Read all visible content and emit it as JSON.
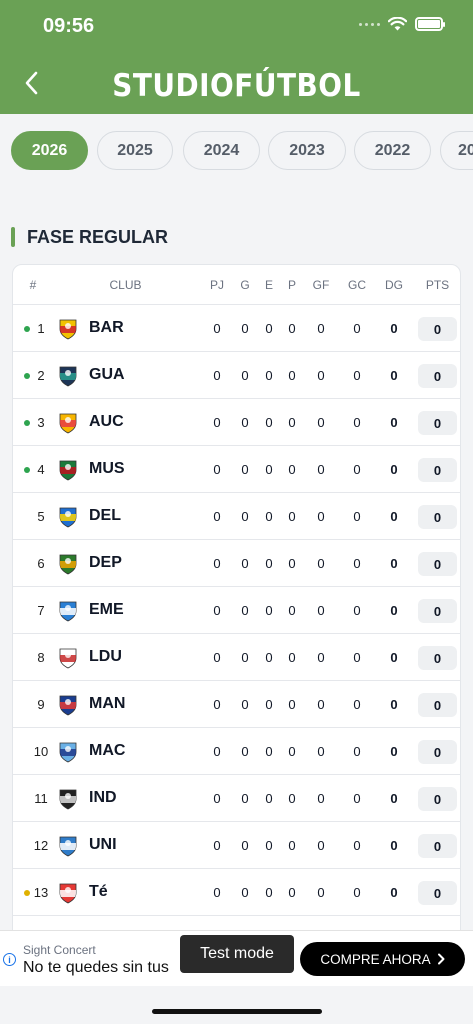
{
  "status_bar": {
    "time": "09:56"
  },
  "header": {
    "title": "STUDIOFÚTBOL",
    "back_icon": "chevron-left-icon"
  },
  "years": [
    "2026",
    "2025",
    "2024",
    "2023",
    "2022",
    "20"
  ],
  "active_year": "2026",
  "section": {
    "title": "FASE REGULAR"
  },
  "table": {
    "columns": [
      "#",
      "CLUB",
      "PJ",
      "G",
      "E",
      "P",
      "GF",
      "GC",
      "DG",
      "PTS"
    ],
    "rows": [
      {
        "pos": "1",
        "club": "BAR",
        "pj": "0",
        "g": "0",
        "e": "0",
        "p": "0",
        "gf": "0",
        "gc": "0",
        "dg": "0",
        "pts": "0",
        "marker": "green"
      },
      {
        "pos": "2",
        "club": "GUA",
        "pj": "0",
        "g": "0",
        "e": "0",
        "p": "0",
        "gf": "0",
        "gc": "0",
        "dg": "0",
        "pts": "0",
        "marker": "green"
      },
      {
        "pos": "3",
        "club": "AUC",
        "pj": "0",
        "g": "0",
        "e": "0",
        "p": "0",
        "gf": "0",
        "gc": "0",
        "dg": "0",
        "pts": "0",
        "marker": "green"
      },
      {
        "pos": "4",
        "club": "MUS",
        "pj": "0",
        "g": "0",
        "e": "0",
        "p": "0",
        "gf": "0",
        "gc": "0",
        "dg": "0",
        "pts": "0",
        "marker": "green"
      },
      {
        "pos": "5",
        "club": "DEL",
        "pj": "0",
        "g": "0",
        "e": "0",
        "p": "0",
        "gf": "0",
        "gc": "0",
        "dg": "0",
        "pts": "0",
        "marker": ""
      },
      {
        "pos": "6",
        "club": "DEP",
        "pj": "0",
        "g": "0",
        "e": "0",
        "p": "0",
        "gf": "0",
        "gc": "0",
        "dg": "0",
        "pts": "0",
        "marker": ""
      },
      {
        "pos": "7",
        "club": "EME",
        "pj": "0",
        "g": "0",
        "e": "0",
        "p": "0",
        "gf": "0",
        "gc": "0",
        "dg": "0",
        "pts": "0",
        "marker": ""
      },
      {
        "pos": "8",
        "club": "LDU",
        "pj": "0",
        "g": "0",
        "e": "0",
        "p": "0",
        "gf": "0",
        "gc": "0",
        "dg": "0",
        "pts": "0",
        "marker": ""
      },
      {
        "pos": "9",
        "club": "MAN",
        "pj": "0",
        "g": "0",
        "e": "0",
        "p": "0",
        "gf": "0",
        "gc": "0",
        "dg": "0",
        "pts": "0",
        "marker": ""
      },
      {
        "pos": "10",
        "club": "MAC",
        "pj": "0",
        "g": "0",
        "e": "0",
        "p": "0",
        "gf": "0",
        "gc": "0",
        "dg": "0",
        "pts": "0",
        "marker": ""
      },
      {
        "pos": "11",
        "club": "IND",
        "pj": "0",
        "g": "0",
        "e": "0",
        "p": "0",
        "gf": "0",
        "gc": "0",
        "dg": "0",
        "pts": "0",
        "marker": ""
      },
      {
        "pos": "12",
        "club": "UNI",
        "pj": "0",
        "g": "0",
        "e": "0",
        "p": "0",
        "gf": "0",
        "gc": "0",
        "dg": "0",
        "pts": "0",
        "marker": ""
      },
      {
        "pos": "13",
        "club": "Té",
        "pj": "0",
        "g": "0",
        "e": "0",
        "p": "0",
        "gf": "0",
        "gc": "0",
        "dg": "0",
        "pts": "0",
        "marker": "yellow"
      }
    ]
  },
  "ad": {
    "source": "Sight Concert",
    "text": "No te quedes sin tus",
    "test_mode": "Test mode",
    "cta": "COMPRE AHORA",
    "info_icon": "info-icon"
  },
  "colors": {
    "brand": "#6aa155",
    "marker_green": "#2ea44f",
    "marker_yellow": "#e0b100"
  }
}
